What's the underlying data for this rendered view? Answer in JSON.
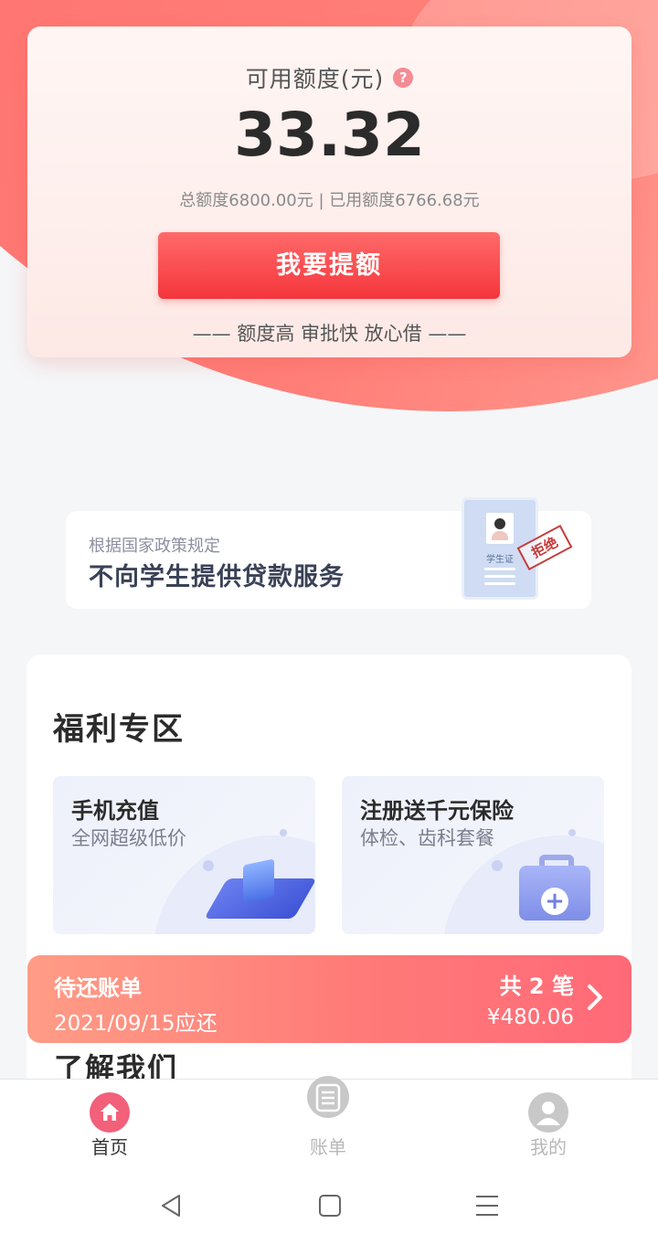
{
  "credit": {
    "label": "可用额度(元)",
    "help_icon": "?",
    "amount": "33.32",
    "detail": "总额度6800.00元 | 已用额度6766.68元",
    "raise_button": "我要提额",
    "slogan": "—— 额度高 审批快 放心借 ——"
  },
  "student_notice": {
    "subtitle": "根据国家政策规定",
    "title": "不向学生提供贷款服务",
    "id_card_text": "学生证",
    "stamp": "拒绝"
  },
  "welfare": {
    "title": "福利专区",
    "items": [
      {
        "title": "手机充值",
        "subtitle": "全网超级低价",
        "icon": "phone-card-icon"
      },
      {
        "title": "注册送千元保险",
        "subtitle": "体检、齿科套餐",
        "icon": "medical-kit-icon"
      }
    ]
  },
  "pending_bill": {
    "title": "待还账单",
    "due_date": "2021/09/15应还",
    "count": "共 2 笔",
    "amount": "¥480.06"
  },
  "about": {
    "title": "了解我们"
  },
  "bottom_nav": {
    "items": [
      {
        "label": "首页",
        "icon": "home-icon",
        "active": true
      },
      {
        "label": "账单",
        "icon": "bill-icon",
        "active": false
      },
      {
        "label": "我的",
        "icon": "user-icon",
        "active": false
      }
    ]
  },
  "colors": {
    "accent": "#f5363c",
    "nav_active": "#f2607a",
    "bill_gradient_start": "#ff9c86",
    "bill_gradient_end": "#ff6a78"
  }
}
